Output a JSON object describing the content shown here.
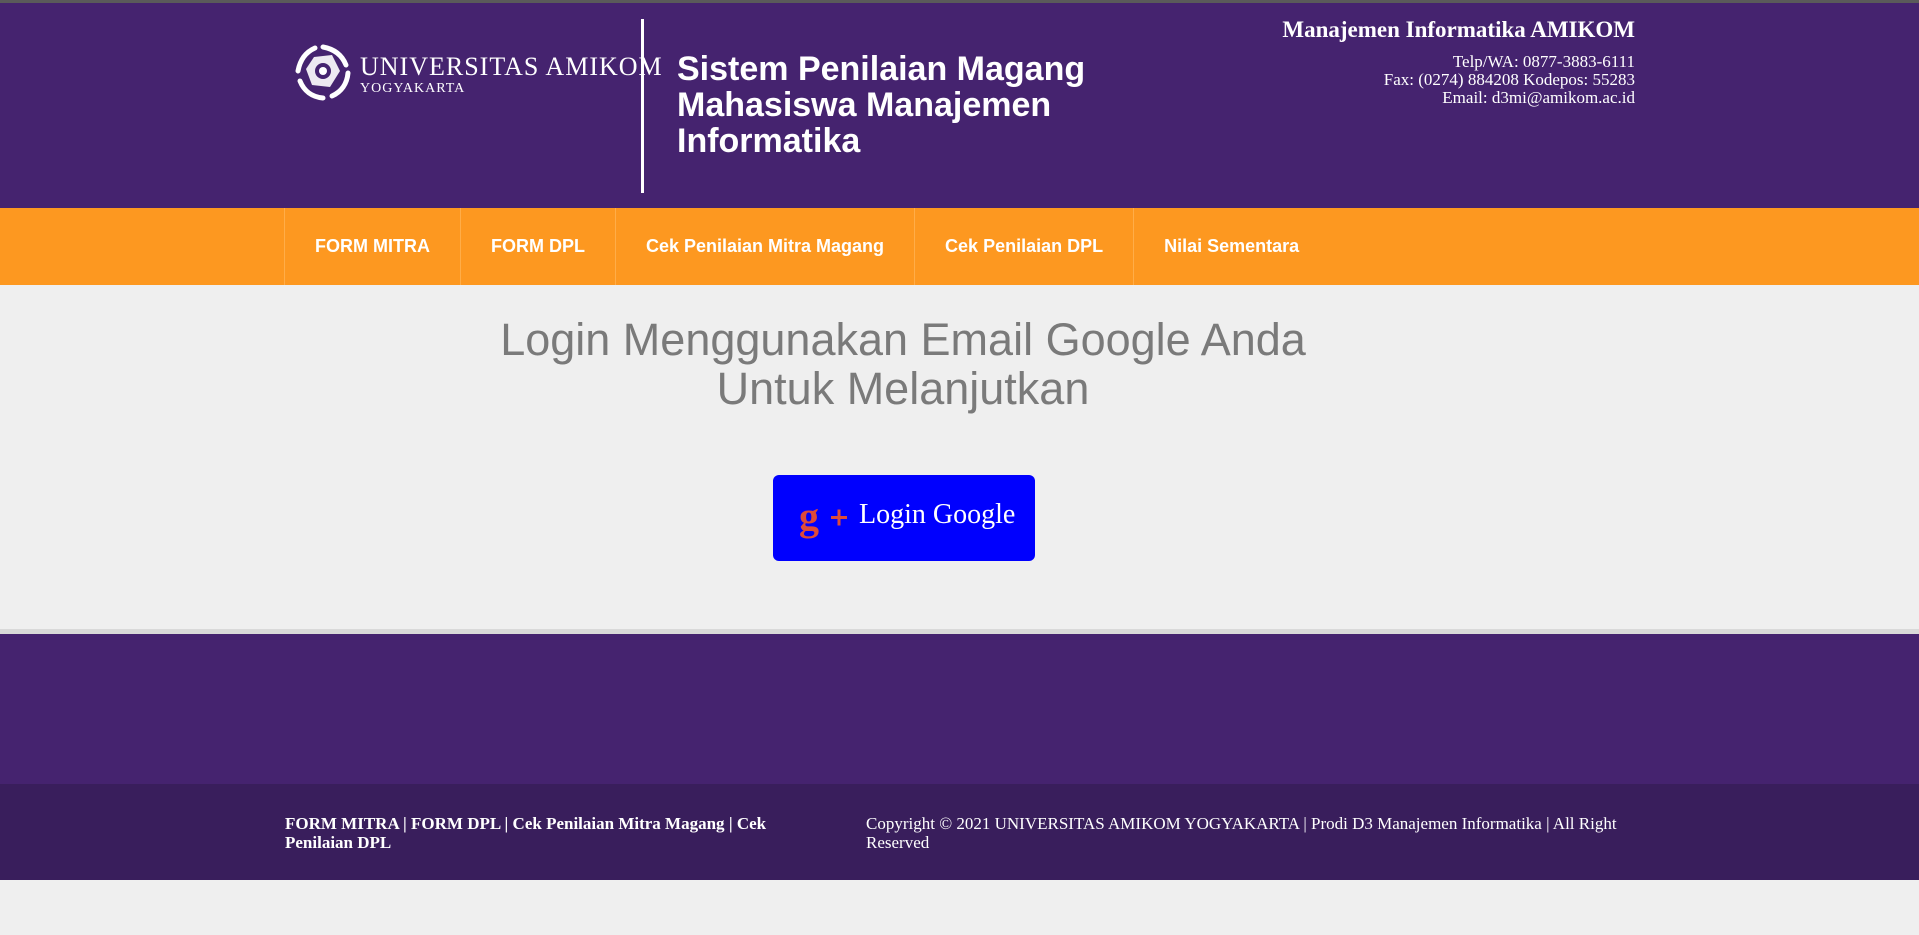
{
  "header": {
    "logo_name": "UNIVERSITAS AMIKOM",
    "logo_sub": "YOGYAKARTA",
    "title": "Sistem Penilaian Magang Mahasiswa Manajemen Informatika",
    "contact": {
      "org": "Manajemen Informatika AMIKOM",
      "phone": "Telp/WA: 0877-3883-6111",
      "fax": "Fax: (0274) 884208 Kodepos: 55283",
      "email": "Email: d3mi@amikom.ac.id"
    }
  },
  "nav": {
    "items": [
      {
        "label": "FORM MITRA"
      },
      {
        "label": "FORM DPL"
      },
      {
        "label": "Cek Penilaian Mitra Magang"
      },
      {
        "label": "Cek Penilaian DPL"
      },
      {
        "label": "Nilai Sementara"
      }
    ]
  },
  "main": {
    "heading": "Login Menggunakan Email Google Anda Untuk Melanjutkan",
    "login_button": "Login Google",
    "login_icon": "google-plus-icon"
  },
  "footer": {
    "links": [
      "FORM MITRA",
      "FORM DPL",
      "Cek Penilaian Mitra Magang",
      "Cek Penilaian DPL"
    ],
    "separator": " | ",
    "copyright": "Copyright © 2021 UNIVERSITAS AMIKOM YOGYAKARTA | Prodi D3 Manajemen Informatika | All Right Reserved"
  },
  "colors": {
    "header_bg": "#45236f",
    "nav_bg": "#fd9820",
    "button_bg": "#0000fe",
    "footer_lower_bg": "#391e5c",
    "page_bg": "#efefef"
  }
}
